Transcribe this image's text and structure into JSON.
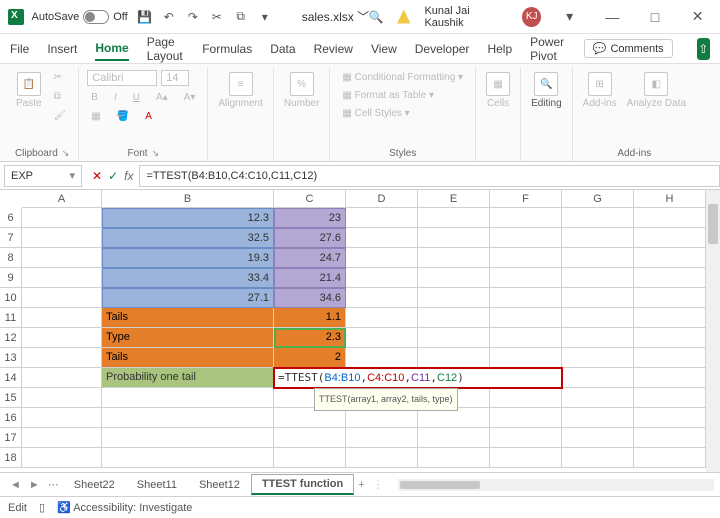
{
  "title_bar": {
    "autosave_label": "AutoSave",
    "autosave_state": "Off",
    "file_name": "sales.xlsx ﹀",
    "user_name": "Kunal Jai Kaushik",
    "user_initials": "KJ"
  },
  "tabs": {
    "items": [
      "File",
      "Insert",
      "Home",
      "Page Layout",
      "Formulas",
      "Data",
      "Review",
      "View",
      "Developer",
      "Help",
      "Power Pivot"
    ],
    "active": "Home",
    "comments": "Comments"
  },
  "ribbon": {
    "clipboard": {
      "paste": "Paste",
      "label": "Clipboard"
    },
    "font": {
      "name": "Calibri",
      "size": "14",
      "label": "Font"
    },
    "alignment": {
      "btn": "Alignment"
    },
    "number": {
      "btn": "Number",
      "fmt": "%"
    },
    "styles": {
      "cond": "Conditional Formatting",
      "table": "Format as Table",
      "cell": "Cell Styles",
      "label": "Styles"
    },
    "cells": {
      "btn": "Cells"
    },
    "editing": {
      "btn": "Editing"
    },
    "addins": {
      "btn": "Add-ins",
      "analyze": "Analyze Data",
      "label": "Add-ins"
    }
  },
  "formula_bar": {
    "name_box": "EXP",
    "fx": "fx",
    "formula": "=TTEST(B4:B10,C4:C10,C11,C12)"
  },
  "grid": {
    "columns": [
      "A",
      "B",
      "C",
      "D",
      "E",
      "F",
      "G",
      "H"
    ],
    "row_start": 6,
    "row_end": 18,
    "data_rows": [
      {
        "r": 6,
        "b": "12.3",
        "c": "23"
      },
      {
        "r": 7,
        "b": "32.5",
        "c": "27.6"
      },
      {
        "r": 8,
        "b": "19.3",
        "c": "24.7"
      },
      {
        "r": 9,
        "b": "33.4",
        "c": "21.4"
      },
      {
        "r": 10,
        "b": "27.1",
        "c": "34.6"
      }
    ],
    "orange_rows": [
      {
        "r": 11,
        "b": "Tails",
        "c": "1.1"
      },
      {
        "r": 12,
        "b": "Type",
        "c": "2.3"
      },
      {
        "r": 13,
        "b": "Tails",
        "c": "2"
      }
    ],
    "result_row": {
      "r": 14,
      "b": "Probability one tail",
      "prefix": "=TTEST(",
      "arg1": "B4:B10",
      "arg2": "C4:C10",
      "arg3": "C11",
      "arg4": "C12",
      "suffix": ")"
    },
    "tooltip": "TTEST(array1, array2, tails, type)"
  },
  "sheet_tabs": {
    "items": [
      "Sheet22",
      "Sheet11",
      "Sheet12",
      "TTEST function"
    ],
    "active": "TTEST function",
    "add": "+",
    "more": "⋯"
  },
  "status_bar": {
    "mode": "Edit",
    "accessibility": "Accessibility: Investigate"
  }
}
